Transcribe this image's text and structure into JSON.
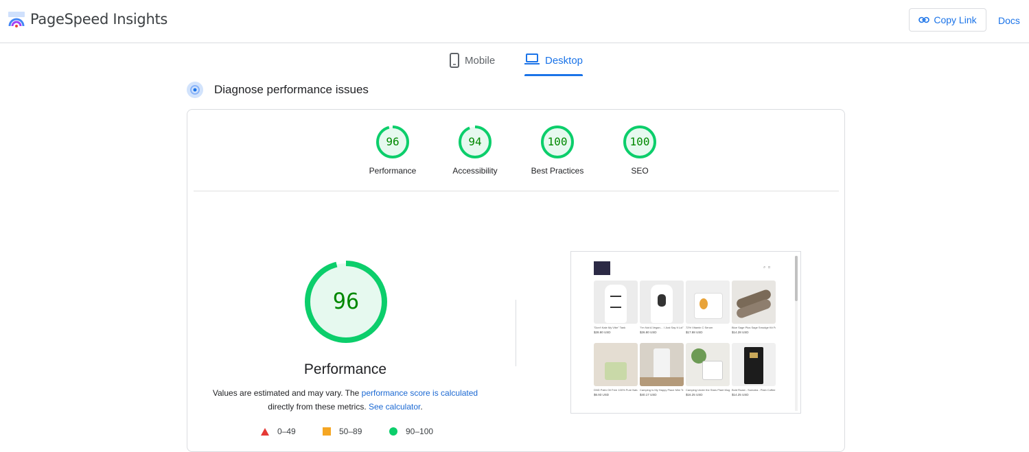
{
  "header": {
    "app_title": "PageSpeed Insights",
    "copy_link_label": "Copy Link",
    "docs_label": "Docs"
  },
  "tabs": [
    {
      "label": "Mobile"
    },
    {
      "label": "Desktop",
      "selected": true
    }
  ],
  "diagnose": {
    "title": "Diagnose performance issues"
  },
  "scores": [
    {
      "label": "Performance",
      "value": "96",
      "fraction": 0.96
    },
    {
      "label": "Accessibility",
      "value": "94",
      "fraction": 0.94
    },
    {
      "label": "Best Practices",
      "value": "100",
      "fraction": 1.0
    },
    {
      "label": "SEO",
      "value": "100",
      "fraction": 1.0
    }
  ],
  "performance": {
    "value": "96",
    "fraction": 0.96,
    "title": "Performance",
    "desc_prefix": "Values are estimated and may vary. The ",
    "score_link": "performance score is calculated",
    "desc_middle": "directly from these metrics. ",
    "calculator_link": "See calculator",
    "desc_suffix": "."
  },
  "legend": [
    {
      "range": "0–49",
      "color": "#e53935",
      "shape": "triangle"
    },
    {
      "range": "50–89",
      "color": "#f5a623",
      "shape": "square"
    },
    {
      "range": "90–100",
      "color": "#0cce6b",
      "shape": "circle"
    }
  ],
  "colors": {
    "accent": "#1a73e8",
    "pass": "#0cce6b",
    "pass_text": "#008800",
    "pass_bg": "#e6f9ef"
  },
  "screenshot": {
    "products": [
      {
        "title": "\"Don't Kale My Vibe\" Tank",
        "price": "$28.80 USD",
        "img": "tank1"
      },
      {
        "title": "\"I'm Not A Vegan… I Just Say It Lol\" Tank",
        "price": "$26.80 USD",
        "img": "tank2"
      },
      {
        "title": "72% Vitamin C Serum",
        "price": "$17.88 USD",
        "img": "jar"
      },
      {
        "title": "Blue Sage Plus Sage Smudge Kit For Cleansing Negative Energy Lavender",
        "price": "$14.28 USD",
        "img": "sage"
      },
      {
        "title": "DND Palm Oil Free 100% Pure Natural Organic Olive Oil Soap with Honey",
        "price": "$6.93 USD",
        "img": "soap"
      },
      {
        "title": "Camping Is My Happy Place Mini Travel Mug",
        "price": "$40.17 USD",
        "img": "tumbler"
      },
      {
        "title": "Camping Under the Stars Plant Mug",
        "price": "$16.25 USD",
        "img": "mug"
      },
      {
        "title": "Bold Roast - Sumatra - Plain Coffee",
        "price": "$14.25 USD",
        "img": "coffee"
      }
    ]
  }
}
